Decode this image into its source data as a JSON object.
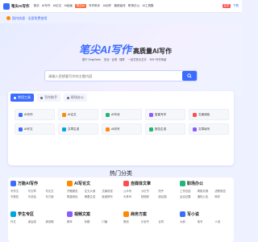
{
  "colors": {
    "accent": "#3b6cff",
    "hot": "#ff6a3d",
    "badge": "#ff4d4f"
  },
  "nav": {
    "logo_text": "笔尖AI写作",
    "items": [
      "首页",
      "AI写作",
      "AI论文",
      "AI绘画",
      "笔尖AI",
      "写作助手",
      "AI创作",
      "营销宣传",
      "职场办公",
      "AI工具集"
    ],
    "badge": "会员",
    "download": "下载"
  },
  "notice": {
    "text": "国内快速 · 全面免费使用"
  },
  "hero": {
    "brand": "笔尖AI写作",
    "subtitle": "高质量AI写作",
    "tags": [
      "基于 DeepSeek",
      "安全 · 合规 · 保障",
      "一站式多元文字",
      "500+写作场景"
    ],
    "search_placeholder": "请输入您想要写作的主题内容"
  },
  "panel": {
    "tabs": [
      "常用工具",
      "写作助手",
      "职场办公"
    ],
    "tools": [
      {
        "label": "AI写作",
        "icon": "write-icon",
        "color": "#3b6cff"
      },
      {
        "label": "AI论文",
        "icon": "paper-icon",
        "color": "#ff8a00"
      },
      {
        "label": "AI写诗",
        "icon": "poem-icon",
        "color": "#22b573"
      },
      {
        "label": "智能写作",
        "icon": "smart-icon",
        "color": "#8a5cff"
      },
      {
        "label": "文案润色",
        "icon": "polish-icon",
        "color": "#ff4d4f"
      },
      {
        "label": "AI作文",
        "icon": "essay-icon",
        "color": "#3b6cff"
      },
      {
        "label": "文章生成",
        "icon": "article-icon",
        "color": "#00a6e0"
      },
      {
        "label": "AI改写",
        "icon": "rewrite-icon",
        "color": "#ff8a00"
      },
      {
        "label": "报告生成",
        "icon": "report-icon",
        "color": "#22b573"
      },
      {
        "label": "文章续写",
        "icon": "continue-icon",
        "color": "#8a5cff"
      }
    ]
  },
  "categories": {
    "title": "热门分类",
    "rows": [
      [
        {
          "name": "万能AI写作",
          "icon": "universal-icon",
          "color": "#3b6cff",
          "links": [
            "写作文",
            "写文章",
            "写论文",
            "写报告",
            "写总结",
            "写方案"
          ]
        },
        {
          "name": "AI写论文",
          "icon": "thesis-icon",
          "color": "#ff8a00",
          "links": [
            "开题报告",
            "论文大纲",
            "文献综述",
            "降重润色",
            "摘要生成",
            "致谢撰写"
          ]
        },
        {
          "name": "自媒体文章",
          "icon": "media-icon",
          "color": "#ff4d4f",
          "links": [
            "公众号",
            "小红书",
            "知乎",
            "头条号",
            "短视频",
            "朋友圈"
          ]
        },
        {
          "name": "职场办公",
          "icon": "office-icon",
          "color": "#22b573",
          "links": [
            "工作总结",
            "周报月报",
            "述职报告",
            "会议纪要",
            "通知公告",
            "邮件"
          ]
        }
      ],
      [
        {
          "name": "学生专区",
          "icon": "student-icon",
          "color": "#00a6e0",
          "links": [
            "作文",
            "读后感",
            "演讲稿"
          ]
        },
        {
          "name": "视频文案",
          "icon": "video-icon",
          "color": "#8a5cff",
          "links": [
            "脚本",
            "标题",
            "口播"
          ]
        },
        {
          "name": "商务方案",
          "icon": "business-icon",
          "color": "#ff8a00",
          "links": [
            "策划",
            "计划书",
            "合同"
          ]
        },
        {
          "name": "写小说",
          "icon": "novel-icon",
          "color": "#3b6cff",
          "links": [
            "大纲",
            "续写",
            "人设"
          ]
        }
      ]
    ]
  }
}
